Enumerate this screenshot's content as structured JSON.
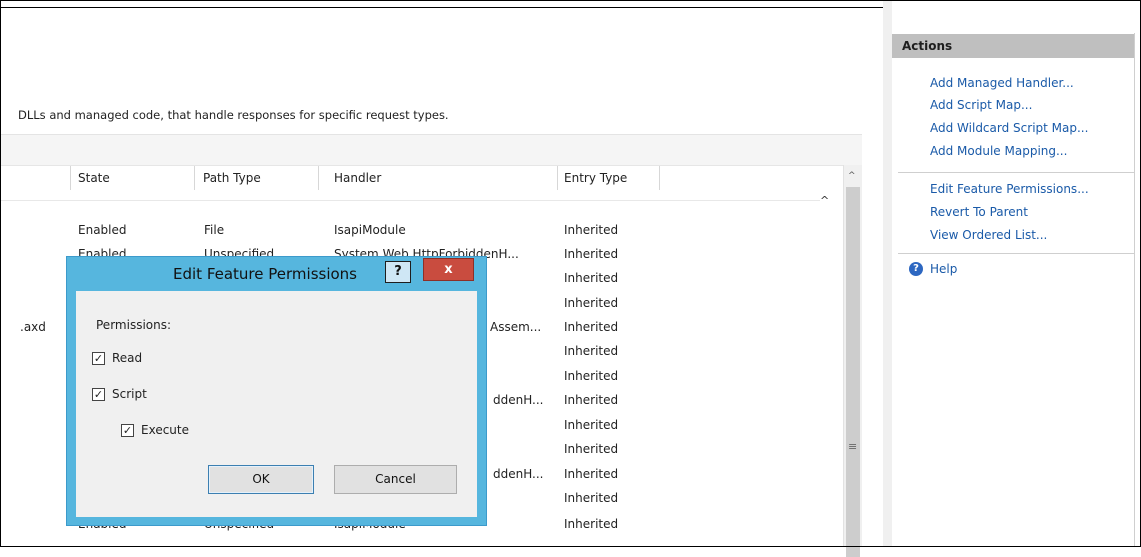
{
  "description": "DLLs and managed code, that handle responses for specific request types.",
  "table": {
    "columns": [
      "State",
      "Path Type",
      "Handler",
      "Entry Type"
    ],
    "rows": [
      {
        "name": "",
        "state": "Enabled",
        "path_type": "File",
        "handler": "IsapiModule",
        "entry_type": "Inherited"
      },
      {
        "name": "",
        "state": "Enabled",
        "path_type": "Unspecified",
        "handler": "System.Web.HttpForbiddenH...",
        "entry_type": "Inherited"
      },
      {
        "name": "",
        "state": "",
        "path_type": "",
        "handler": "",
        "entry_type": "Inherited"
      },
      {
        "name": "",
        "state": "",
        "path_type": "",
        "handler": "",
        "entry_type": "Inherited"
      },
      {
        "name": ".axd",
        "state": "",
        "path_type": "",
        "handler": "Assem...",
        "entry_type": "Inherited"
      },
      {
        "name": "",
        "state": "",
        "path_type": "",
        "handler": "",
        "entry_type": "Inherited"
      },
      {
        "name": "",
        "state": "",
        "path_type": "",
        "handler": "",
        "entry_type": "Inherited"
      },
      {
        "name": "",
        "state": "",
        "path_type": "",
        "handler": "ddenH...",
        "entry_type": "Inherited"
      },
      {
        "name": "",
        "state": "",
        "path_type": "",
        "handler": "",
        "entry_type": "Inherited"
      },
      {
        "name": "",
        "state": "",
        "path_type": "",
        "handler": "",
        "entry_type": "Inherited"
      },
      {
        "name": "",
        "state": "",
        "path_type": "",
        "handler": "ddenH...",
        "entry_type": "Inherited"
      },
      {
        "name": "",
        "state": "",
        "path_type": "",
        "handler": "",
        "entry_type": "Inherited"
      },
      {
        "name": "",
        "state": "Enabled",
        "path_type": "Unspecified",
        "handler": "IsapiModule",
        "entry_type": "Inherited"
      }
    ]
  },
  "actions": {
    "title": "Actions",
    "group1": [
      "Add Managed Handler...",
      "Add Script Map...",
      "Add Wildcard Script Map...",
      "Add Module Mapping..."
    ],
    "group2": [
      "Edit Feature Permissions...",
      "Revert To Parent",
      "View Ordered List..."
    ],
    "help": "Help"
  },
  "dialog": {
    "title": "Edit Feature Permissions",
    "help_button": "?",
    "close_button": "x",
    "permissions_label": "Permissions:",
    "read": {
      "label": "Read",
      "checked": true
    },
    "script": {
      "label": "Script",
      "checked": true
    },
    "execute": {
      "label": "Execute",
      "checked": true
    },
    "ok_label": "OK",
    "cancel_label": "Cancel"
  },
  "colors": {
    "dialog_frame": "#56b6de",
    "close_button": "#c94c3f",
    "link": "#1a5aa8",
    "actions_header": "#bfbfbf"
  }
}
